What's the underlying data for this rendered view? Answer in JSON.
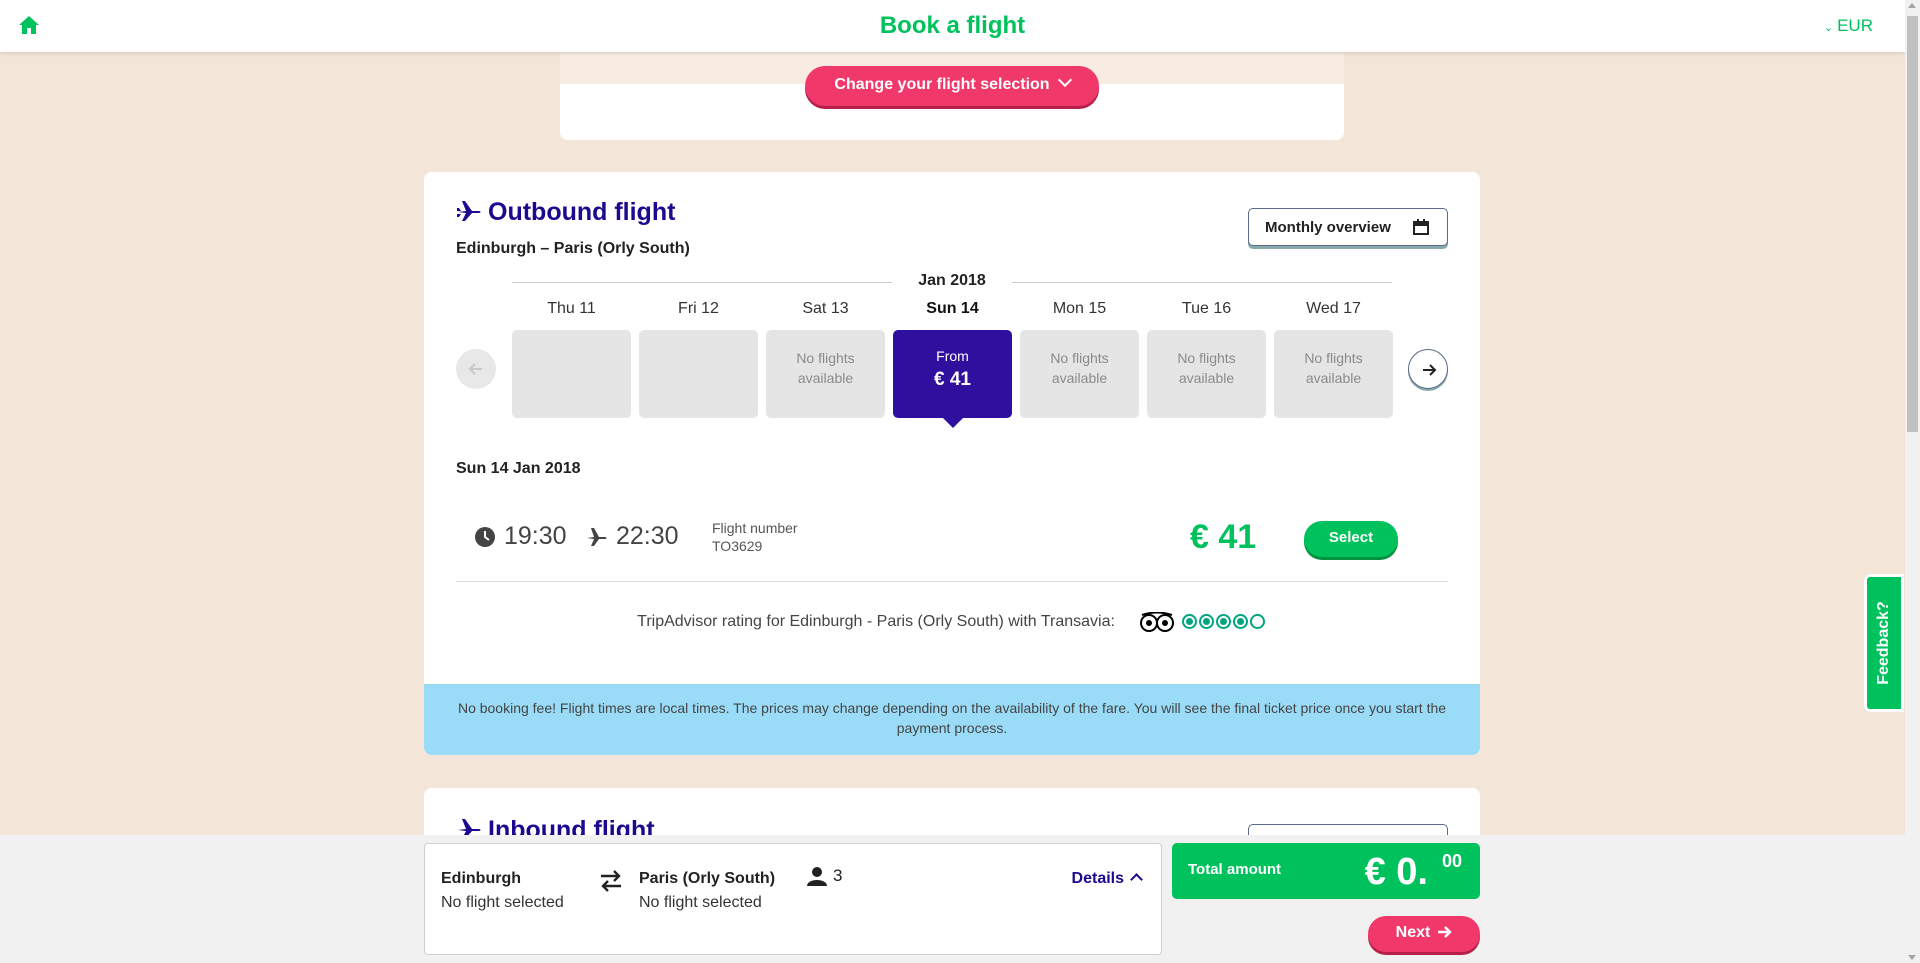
{
  "header": {
    "title": "Book a flight",
    "currency": "EUR",
    "home_icon": "home-icon"
  },
  "change_selection": {
    "label": "Change your flight selection"
  },
  "outbound": {
    "title": "Outbound flight",
    "route": "Edinburgh – Paris (Orly South)",
    "monthly_overview_label": "Monthly overview",
    "month": "Jan 2018",
    "days": [
      {
        "label": "Thu 11",
        "line1": "",
        "line2": "",
        "state": "empty"
      },
      {
        "label": "Fri 12",
        "line1": "",
        "line2": "",
        "state": "empty"
      },
      {
        "label": "Sat 13",
        "line1": "No flights",
        "line2": "available",
        "state": "none"
      },
      {
        "label": "Sun 14",
        "line1": "From",
        "line2": "€ 41",
        "state": "selected"
      },
      {
        "label": "Mon 15",
        "line1": "No flights",
        "line2": "available",
        "state": "none"
      },
      {
        "label": "Tue 16",
        "line1": "No flights",
        "line2": "available",
        "state": "none"
      },
      {
        "label": "Wed 17",
        "line1": "No flights",
        "line2": "available",
        "state": "none"
      }
    ],
    "selected_date": "Sun 14 Jan 2018",
    "flight": {
      "departure": "19:30",
      "arrival": "22:30",
      "flight_number_label": "Flight number",
      "flight_number": "TO3629",
      "price": "€ 41",
      "select_label": "Select"
    },
    "tripadvisor": {
      "text": "TripAdvisor rating for Edinburgh - Paris (Orly South) with Transavia:",
      "rating": 4,
      "max_rating": 5
    },
    "notice": "No booking fee! Flight times are local times. The prices may change depending on the availability of the fare. You will see the final ticket price once you start the payment process."
  },
  "inbound": {
    "title": "Inbound flight"
  },
  "summary": {
    "from_city": "Edinburgh",
    "from_status": "No flight selected",
    "to_city": "Paris (Orly South)",
    "to_status": "No flight selected",
    "passengers": "3",
    "details_label": "Details"
  },
  "total": {
    "label": "Total amount",
    "amount": "€ 0.",
    "cents": "00"
  },
  "next_label": "Next",
  "feedback_label": "Feedback?",
  "colors": {
    "brand_green": "#00c25d",
    "brand_pink": "#f0386b",
    "brand_navy": "#1b0a8f",
    "selected_day": "#2f0f9e",
    "notice_bg": "#9adcf8",
    "page_bg": "#f3e5d8"
  }
}
